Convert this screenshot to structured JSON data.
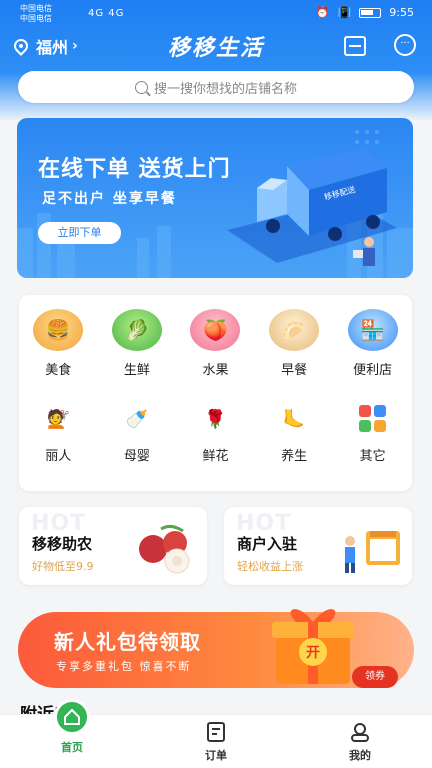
{
  "status_bar": {
    "carrier_1": "中国电信",
    "carrier_2": "中国电信",
    "signal": "4G 4G",
    "time": "9:55"
  },
  "header": {
    "city": "福州",
    "brand": "移移生活",
    "icons": [
      "location-icon",
      "scan-icon",
      "message-icon"
    ]
  },
  "search": {
    "placeholder": "搜一搜你想找的店铺名称"
  },
  "banner": {
    "title": "在线下单  送货上门",
    "subtitle": "足不出户  坐享早餐",
    "button": "立即下单",
    "truck_text": "移移配送"
  },
  "categories": [
    {
      "label": "美食",
      "icon": "food-icon"
    },
    {
      "label": "生鲜",
      "icon": "fresh-icon"
    },
    {
      "label": "水果",
      "icon": "fruit-icon"
    },
    {
      "label": "早餐",
      "icon": "breakfast-icon"
    },
    {
      "label": "便利店",
      "icon": "store-icon"
    },
    {
      "label": "丽人",
      "icon": "beauty-icon"
    },
    {
      "label": "母婴",
      "icon": "baby-icon"
    },
    {
      "label": "鲜花",
      "icon": "flower-icon"
    },
    {
      "label": "养生",
      "icon": "wellness-icon"
    },
    {
      "label": "其它",
      "icon": "other-icon"
    }
  ],
  "promos": [
    {
      "hot": "HOT",
      "title": "移移助农",
      "subtitle": "好物低至9.9"
    },
    {
      "hot": "HOT",
      "title": "商户入驻",
      "subtitle": "轻松收益上涨"
    }
  ],
  "gift_banner": {
    "title": "新人礼包待领取",
    "subtitle": "专享多重礼包  惊喜不断",
    "box_label": "开",
    "coupon": "领券"
  },
  "nearby_title": "附近店铺",
  "tabbar": [
    {
      "label": "首页",
      "active": true
    },
    {
      "label": "订单",
      "active": false
    },
    {
      "label": "我的",
      "active": false
    }
  ],
  "colors": {
    "primary_blue": "#1f7ef2",
    "accent_green": "#29a24a",
    "promo_orange": "#fb5a3b"
  }
}
